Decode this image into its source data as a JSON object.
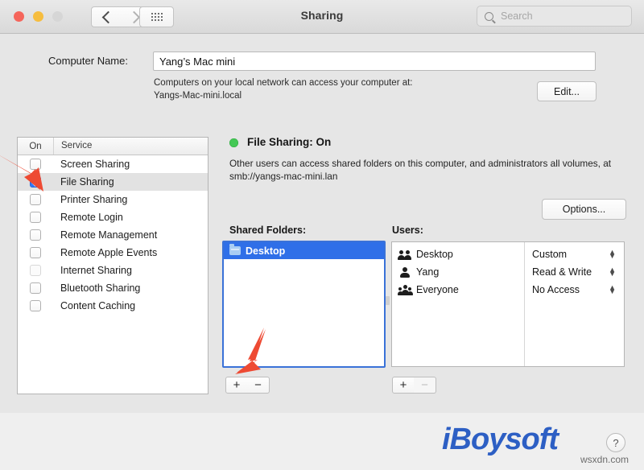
{
  "window": {
    "title": "Sharing",
    "traffic_lights": [
      "close",
      "minimize",
      "zoom"
    ],
    "nav": {
      "back_icon": "chevron-left-icon",
      "forward_icon": "chevron-right-icon",
      "grid_icon": "show-all-grid-icon"
    },
    "search": {
      "placeholder": "Search",
      "value": "",
      "icon": "search-icon"
    }
  },
  "computer_name": {
    "label": "Computer Name:",
    "value": "Yang’s Mac mini",
    "placeholder": "",
    "hint_line1": "Computers on your local network can access your computer at:",
    "hint_line2": "Yangs-Mac-mini.local",
    "edit_label": "Edit..."
  },
  "services": {
    "columns": {
      "on": "On",
      "service": "Service"
    },
    "items": [
      {
        "label": "Screen Sharing",
        "checked": false,
        "enabled": true,
        "selected": false
      },
      {
        "label": "File Sharing",
        "checked": true,
        "enabled": true,
        "selected": true
      },
      {
        "label": "Printer Sharing",
        "checked": false,
        "enabled": true,
        "selected": false
      },
      {
        "label": "Remote Login",
        "checked": false,
        "enabled": true,
        "selected": false
      },
      {
        "label": "Remote Management",
        "checked": false,
        "enabled": true,
        "selected": false
      },
      {
        "label": "Remote Apple Events",
        "checked": false,
        "enabled": true,
        "selected": false
      },
      {
        "label": "Internet Sharing",
        "checked": false,
        "enabled": false,
        "selected": false
      },
      {
        "label": "Bluetooth Sharing",
        "checked": false,
        "enabled": true,
        "selected": false
      },
      {
        "label": "Content Caching",
        "checked": false,
        "enabled": true,
        "selected": false
      }
    ]
  },
  "detail": {
    "status_title": "File Sharing: On",
    "status_color": "#44c855",
    "description": "Other users can access shared folders on this computer, and administrators all volumes, at smb://yangs-mac-mini.lan",
    "options_label": "Options..."
  },
  "shared_folders": {
    "label": "Shared Folders:",
    "items": [
      {
        "name": "Desktop",
        "icon": "folder-icon",
        "selected": true
      }
    ],
    "add_label": "+",
    "remove_label": "−"
  },
  "users": {
    "label": "Users:",
    "items": [
      {
        "name": "Desktop",
        "icon": "two-people-icon",
        "permission": "Custom"
      },
      {
        "name": "Yang",
        "icon": "person-icon",
        "permission": "Read & Write"
      },
      {
        "name": "Everyone",
        "icon": "three-people-icon",
        "permission": "No Access"
      }
    ],
    "add_label": "+",
    "remove_label": "−",
    "remove_enabled": false
  },
  "annotations": {
    "arrow_color": "#ee4a33",
    "arrows": [
      {
        "name": "arrow-to-file-sharing-checkbox",
        "target": "File Sharing checkbox"
      },
      {
        "name": "arrow-to-add-shared-folder",
        "target": "Shared Folders add button"
      }
    ]
  },
  "footer": {
    "brand": "iBoysoft",
    "brand_color": "#2d5fc4",
    "help_label": "?",
    "watermark": "wsxdn.com"
  }
}
